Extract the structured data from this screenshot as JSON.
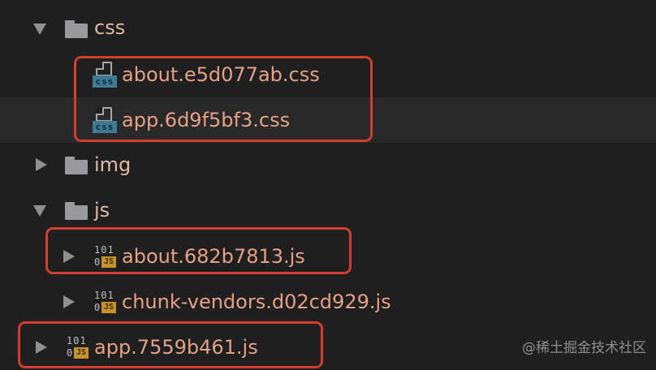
{
  "tree": {
    "folders": {
      "css": "css",
      "img": "img",
      "js": "js"
    },
    "files": {
      "about_css": "about.e5d077ab.css",
      "app_css": "app.6d9f5bf3.css",
      "about_js": "about.682b7813.js",
      "chunk_vendors_js": "chunk-vendors.d02cd929.js",
      "app_js": "app.7559b461.js"
    },
    "icons": {
      "css_tag": "css",
      "js_tag": "JS",
      "js_bits_top": "101",
      "js_bits_bottom": "0"
    }
  },
  "watermark": "@稀土掘金技术社区",
  "colors": {
    "background": "#1f1f20",
    "selected_row": "#29292a",
    "highlight_border": "#d23d2f",
    "file_text": "#e4a184"
  }
}
